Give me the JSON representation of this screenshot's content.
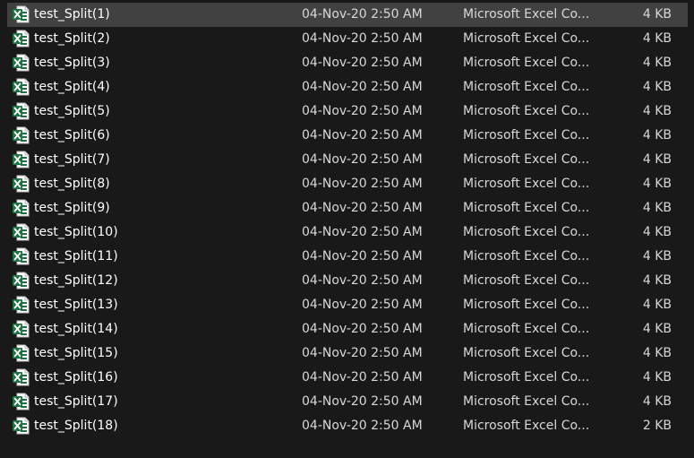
{
  "file_icon": "excel-file-icon",
  "selected_index": 0,
  "files": [
    {
      "name": "test_Split(1)",
      "date_modified": "04-Nov-20 2:50 AM",
      "type": "Microsoft Excel Co...",
      "size": "4 KB"
    },
    {
      "name": "test_Split(2)",
      "date_modified": "04-Nov-20 2:50 AM",
      "type": "Microsoft Excel Co...",
      "size": "4 KB"
    },
    {
      "name": "test_Split(3)",
      "date_modified": "04-Nov-20 2:50 AM",
      "type": "Microsoft Excel Co...",
      "size": "4 KB"
    },
    {
      "name": "test_Split(4)",
      "date_modified": "04-Nov-20 2:50 AM",
      "type": "Microsoft Excel Co...",
      "size": "4 KB"
    },
    {
      "name": "test_Split(5)",
      "date_modified": "04-Nov-20 2:50 AM",
      "type": "Microsoft Excel Co...",
      "size": "4 KB"
    },
    {
      "name": "test_Split(6)",
      "date_modified": "04-Nov-20 2:50 AM",
      "type": "Microsoft Excel Co...",
      "size": "4 KB"
    },
    {
      "name": "test_Split(7)",
      "date_modified": "04-Nov-20 2:50 AM",
      "type": "Microsoft Excel Co...",
      "size": "4 KB"
    },
    {
      "name": "test_Split(8)",
      "date_modified": "04-Nov-20 2:50 AM",
      "type": "Microsoft Excel Co...",
      "size": "4 KB"
    },
    {
      "name": "test_Split(9)",
      "date_modified": "04-Nov-20 2:50 AM",
      "type": "Microsoft Excel Co...",
      "size": "4 KB"
    },
    {
      "name": "test_Split(10)",
      "date_modified": "04-Nov-20 2:50 AM",
      "type": "Microsoft Excel Co...",
      "size": "4 KB"
    },
    {
      "name": "test_Split(11)",
      "date_modified": "04-Nov-20 2:50 AM",
      "type": "Microsoft Excel Co...",
      "size": "4 KB"
    },
    {
      "name": "test_Split(12)",
      "date_modified": "04-Nov-20 2:50 AM",
      "type": "Microsoft Excel Co...",
      "size": "4 KB"
    },
    {
      "name": "test_Split(13)",
      "date_modified": "04-Nov-20 2:50 AM",
      "type": "Microsoft Excel Co...",
      "size": "4 KB"
    },
    {
      "name": "test_Split(14)",
      "date_modified": "04-Nov-20 2:50 AM",
      "type": "Microsoft Excel Co...",
      "size": "4 KB"
    },
    {
      "name": "test_Split(15)",
      "date_modified": "04-Nov-20 2:50 AM",
      "type": "Microsoft Excel Co...",
      "size": "4 KB"
    },
    {
      "name": "test_Split(16)",
      "date_modified": "04-Nov-20 2:50 AM",
      "type": "Microsoft Excel Co...",
      "size": "4 KB"
    },
    {
      "name": "test_Split(17)",
      "date_modified": "04-Nov-20 2:50 AM",
      "type": "Microsoft Excel Co...",
      "size": "4 KB"
    },
    {
      "name": "test_Split(18)",
      "date_modified": "04-Nov-20 2:50 AM",
      "type": "Microsoft Excel Co...",
      "size": "2 KB"
    }
  ]
}
